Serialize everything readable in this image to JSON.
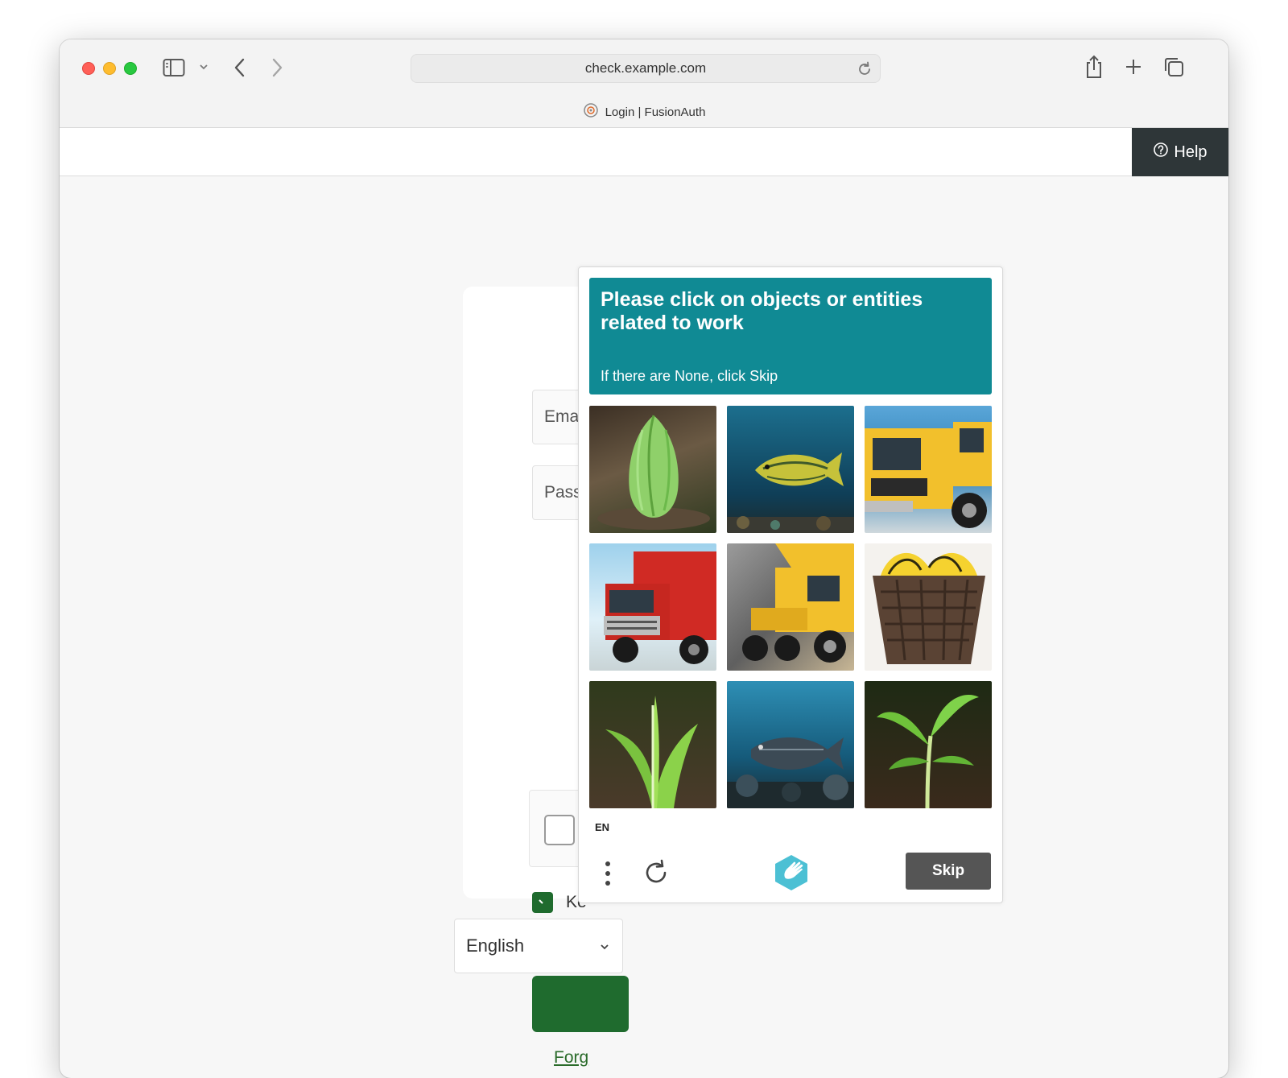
{
  "browser": {
    "url": "check.example.com",
    "tab_title": "Login | FusionAuth"
  },
  "header": {
    "help_label": "Help"
  },
  "login": {
    "email_placeholder": "Email",
    "password_placeholder": "Passw",
    "keep_label": "Ke",
    "forgot_link": "Forg"
  },
  "language_select": {
    "selected": "English"
  },
  "captcha": {
    "prompt": "Please click on objects or entities related to work",
    "subtext": "If there are None, click Skip",
    "language": "EN",
    "skip_label": "Skip",
    "tiles": [
      {
        "subject": "green-vegetable"
      },
      {
        "subject": "fish-underwater"
      },
      {
        "subject": "yellow-truck"
      },
      {
        "subject": "red-truck"
      },
      {
        "subject": "yellow-dump-truck"
      },
      {
        "subject": "banana-basket"
      },
      {
        "subject": "green-plant"
      },
      {
        "subject": "fish-underwater"
      },
      {
        "subject": "green-seedling"
      }
    ]
  },
  "colors": {
    "captcha_header": "#108a94",
    "brand_green": "#1f6b2e",
    "help_bg": "#2e3638"
  }
}
